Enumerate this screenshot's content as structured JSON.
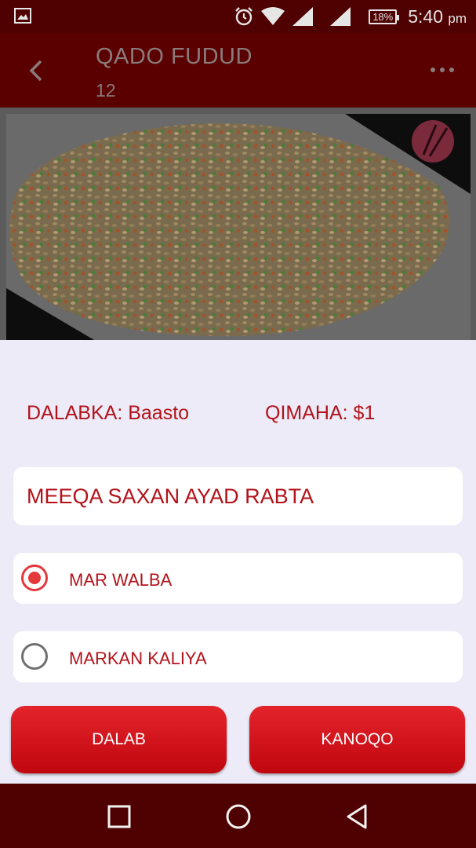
{
  "status_bar": {
    "time": "5:40",
    "ampm": "pm",
    "battery": "18%",
    "icons": [
      "gallery-icon",
      "alarm-icon",
      "wifi-icon",
      "signal-icon",
      "signal-icon",
      "battery-icon"
    ]
  },
  "app_bar": {
    "title": "QADO FUDUD",
    "subtitle": "12",
    "icons": [
      "back-arrow-icon",
      "more-options-icon"
    ]
  },
  "food_image": {
    "description_icon": "fried-rice-photo",
    "logo": "chopsticks-logo"
  },
  "order": {
    "item_label": "DALABKA: Baasto",
    "price_label": "QIMAHA: $1"
  },
  "question": {
    "text": "MEEQA SAXAN AYAD RABTA"
  },
  "options": [
    {
      "label": "MAR WALBA",
      "selected": true
    },
    {
      "label": "MARKAN KALIYA",
      "selected": false
    }
  ],
  "buttons": {
    "order_label": "DALAB",
    "cancel_label": "KANOQO"
  },
  "nav_bar": {
    "icons": [
      "recent-apps-icon",
      "home-icon",
      "back-triangle-icon"
    ]
  },
  "colors": {
    "primary_dark": "#5a0000",
    "accent_red": "#b3121a",
    "button_red": "#d8131b",
    "radio_selected": "#e5383b",
    "background": "#ecebf7"
  }
}
